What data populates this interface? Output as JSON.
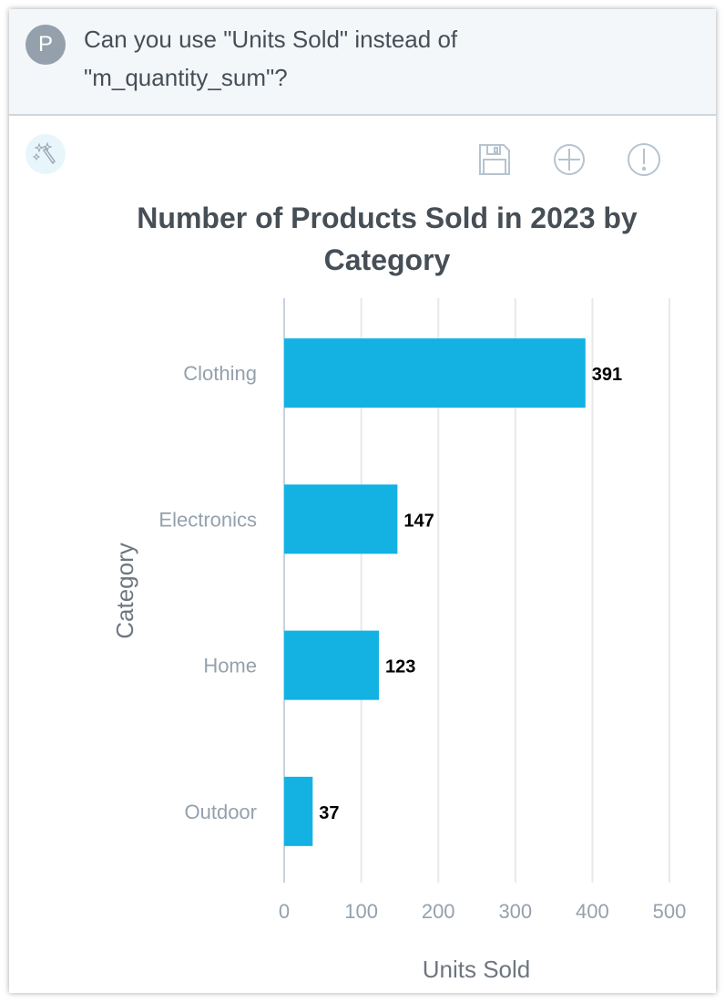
{
  "message": {
    "avatar_initial": "P",
    "text": "Can you use \"Units Sold\" instead of \"m_quantity_sum\"?"
  },
  "toolbar": {
    "icons": [
      "magic-wand-icon",
      "save-icon",
      "add-circle-icon",
      "alert-icon"
    ]
  },
  "colors": {
    "bar": "#14b2e2",
    "grid": "#e6e9ec",
    "axis": "#c8d4e2",
    "tick_text": "#94a1ad",
    "axis_label": "#6d7680",
    "title": "#464e56"
  },
  "chart_data": {
    "type": "bar",
    "orientation": "horizontal",
    "title": "Number of Products Sold in 2023 by Category",
    "xlabel": "Units Sold",
    "ylabel": "Category",
    "categories": [
      "Clothing",
      "Electronics",
      "Home",
      "Outdoor"
    ],
    "values": [
      391,
      147,
      123,
      37
    ],
    "data_labels": [
      "391",
      "147",
      "123",
      "37"
    ],
    "xlim": [
      0,
      500
    ],
    "xticks": [
      0,
      100,
      200,
      300,
      400,
      500
    ],
    "xtick_labels": [
      "0",
      "100",
      "200",
      "300",
      "400",
      "500"
    ],
    "grid": true,
    "legend": "none"
  }
}
